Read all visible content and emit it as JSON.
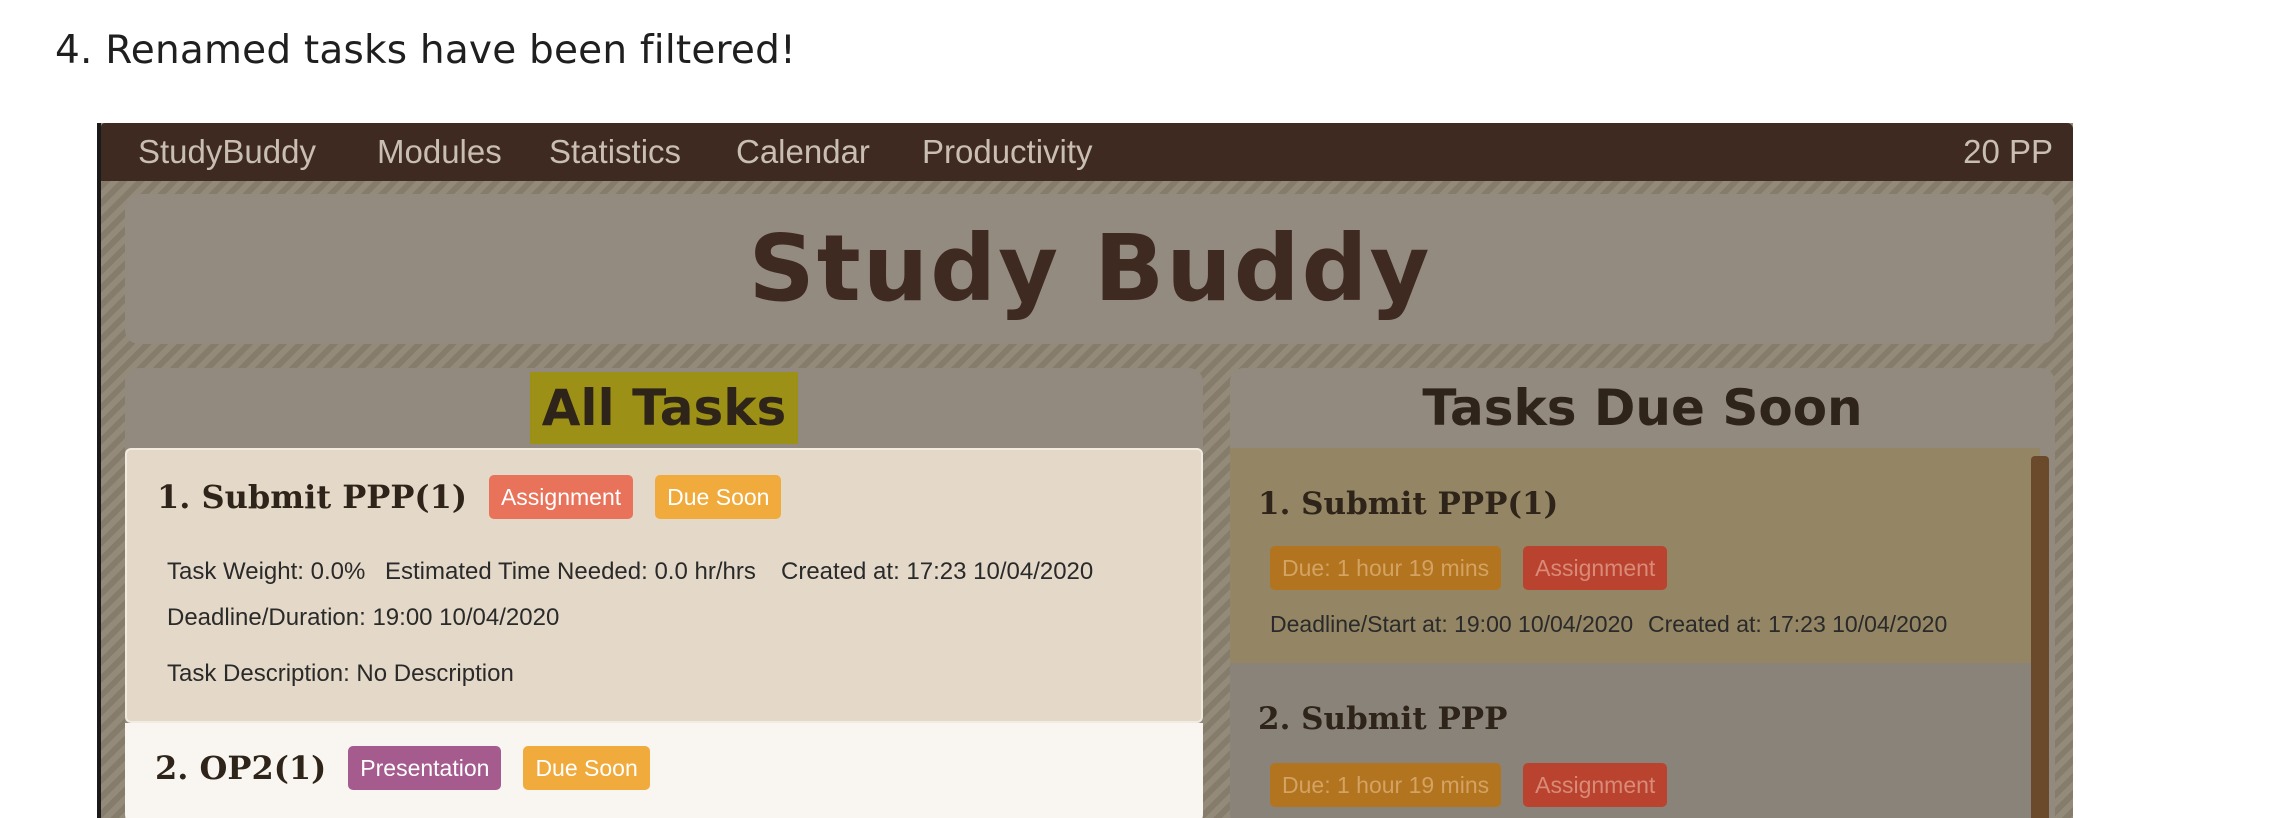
{
  "heading": "4. Renamed tasks have been filtered!",
  "menu": {
    "items": [
      "StudyBuddy",
      "Modules",
      "Statistics",
      "Calendar",
      "Productivity"
    ],
    "points": "20 PP"
  },
  "app_title": "Study Buddy",
  "all_tasks": {
    "heading": "All Tasks",
    "tasks": [
      {
        "name": "1. Submit PPP(1)",
        "tags": [
          "Assignment",
          "Due Soon"
        ],
        "weight": "Task Weight: 0.0%",
        "estimated": "Estimated Time Needed: 0.0 hr/hrs",
        "created": "Created at: 17:23 10/04/2020",
        "deadline": "Deadline/Duration: 19:00 10/04/2020",
        "description": "Task Description: No Description"
      },
      {
        "name": "2. OP2(1)",
        "tags": [
          "Presentation",
          "Due Soon"
        ]
      }
    ]
  },
  "due_soon": {
    "heading": "Tasks Due Soon",
    "tasks": [
      {
        "name": "1. Submit PPP(1)",
        "due": "Due: 1 hour 19 mins",
        "type": "Assignment",
        "deadline": "Deadline/Start at: 19:00 10/04/2020",
        "created": "Created at: 17:23 10/04/2020"
      },
      {
        "name": "2. Submit PPP",
        "due": "Due: 1 hour 19 mins",
        "type": "Assignment"
      }
    ]
  },
  "colors": {
    "menu_bar": "#3e2a20",
    "title_text": "#3e2a20",
    "assignment_tag": "#e8725a",
    "presentation_tag": "#a55b8e",
    "due_soon_tag": "#f0ab3c",
    "heading_highlight": "#9c9016"
  }
}
